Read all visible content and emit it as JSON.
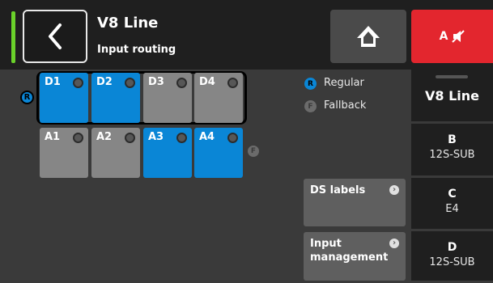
{
  "header": {
    "title": "V8 Line",
    "subtitle": "Input routing",
    "mute_label": "A",
    "status_color": "#6ad12a",
    "mute_color": "#e3262e"
  },
  "routing": {
    "digital": [
      {
        "label": "D1",
        "state": "regular"
      },
      {
        "label": "D2",
        "state": "regular"
      },
      {
        "label": "D3",
        "state": "off"
      },
      {
        "label": "D4",
        "state": "off"
      }
    ],
    "analog": [
      {
        "label": "A1",
        "state": "off"
      },
      {
        "label": "A2",
        "state": "off"
      },
      {
        "label": "A3",
        "state": "fallback"
      },
      {
        "label": "A4",
        "state": "fallback"
      }
    ],
    "regular_badge": "R",
    "fallback_badge": "F"
  },
  "legend": {
    "regular_label": "Regular",
    "fallback_label": "Fallback",
    "regular_icon": "R",
    "fallback_icon": "F"
  },
  "buttons": {
    "ds_labels": "DS labels",
    "input_management_line1": "Input",
    "input_management_line2": "management"
  },
  "side_panel": {
    "title": "V8 Line",
    "zones": [
      {
        "letter": "B",
        "name": "12S-SUB"
      },
      {
        "letter": "C",
        "name": "E4"
      },
      {
        "letter": "D",
        "name": "12S-SUB"
      }
    ]
  }
}
